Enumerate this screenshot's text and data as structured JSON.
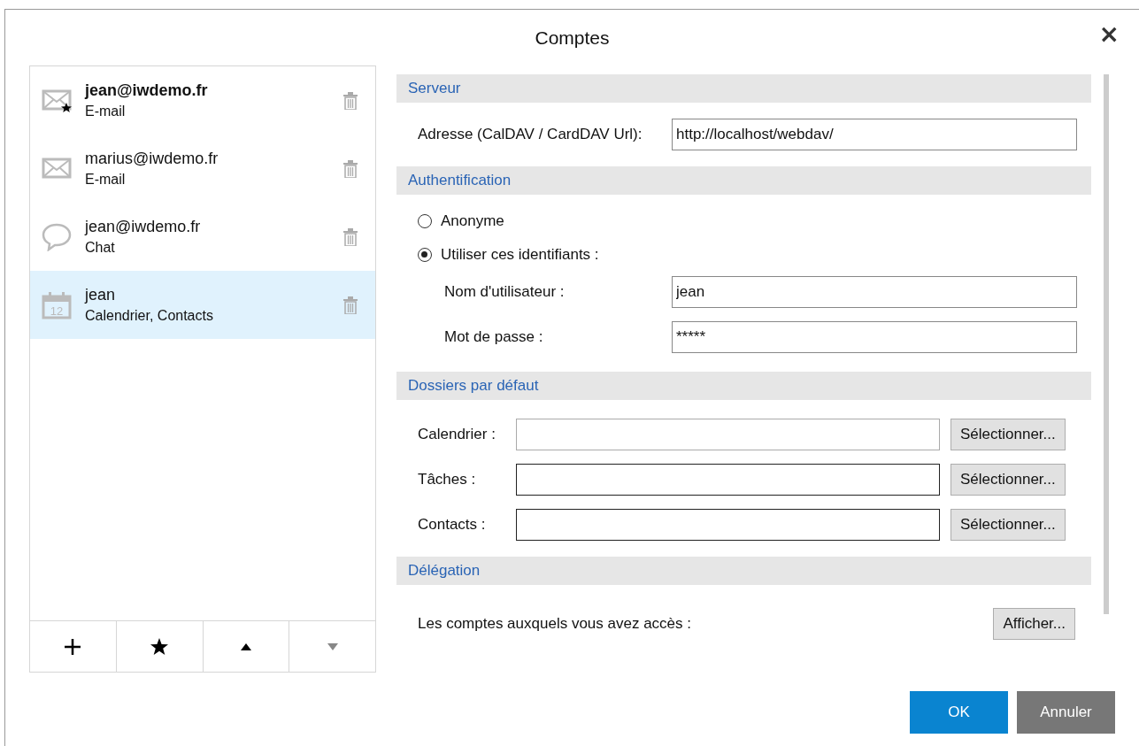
{
  "window": {
    "title": "Comptes",
    "close": "×"
  },
  "accounts": [
    {
      "name": "jean@iwdemo.fr",
      "type": "E-mail",
      "kind": "email",
      "default": true,
      "selected": false
    },
    {
      "name": "marius@iwdemo.fr",
      "type": "E-mail",
      "kind": "email",
      "default": false,
      "selected": false
    },
    {
      "name": "jean@iwdemo.fr",
      "type": "Chat",
      "kind": "chat",
      "default": false,
      "selected": false
    },
    {
      "name": "jean",
      "type": "Calendrier, Contacts",
      "kind": "calendar",
      "icon_text": "12",
      "default": false,
      "selected": true
    }
  ],
  "toolbar": [
    {
      "kind": "add",
      "disabled": false
    },
    {
      "kind": "star",
      "disabled": false
    },
    {
      "kind": "up",
      "disabled": false
    },
    {
      "kind": "down",
      "disabled": true
    }
  ],
  "server": {
    "title": "Serveur",
    "address_label": "Adresse (CalDAV / CardDAV Url):",
    "address": "http://localhost/webdav/"
  },
  "auth": {
    "title": "Authentification",
    "options": [
      {
        "label": "Anonyme",
        "selected": false
      },
      {
        "label": "Utiliser ces identifiants :",
        "selected": true
      }
    ],
    "username_label": "Nom d'utilisateur :",
    "username": "jean",
    "password_label": "Mot de passe :",
    "password": "*****"
  },
  "folders": {
    "title": "Dossiers par défaut",
    "rows": [
      {
        "label": "Calendrier :",
        "button": "Sélectionner..."
      },
      {
        "label": "Tâches :",
        "button": "Sélectionner..."
      },
      {
        "label": "Contacts :",
        "button": "Sélectionner..."
      }
    ]
  },
  "delegation": {
    "title": "Délégation",
    "label": "Les comptes auxquels vous avez accès :",
    "button": "Afficher..."
  },
  "buttons": {
    "ok": "OK",
    "cancel": "Annuler"
  }
}
